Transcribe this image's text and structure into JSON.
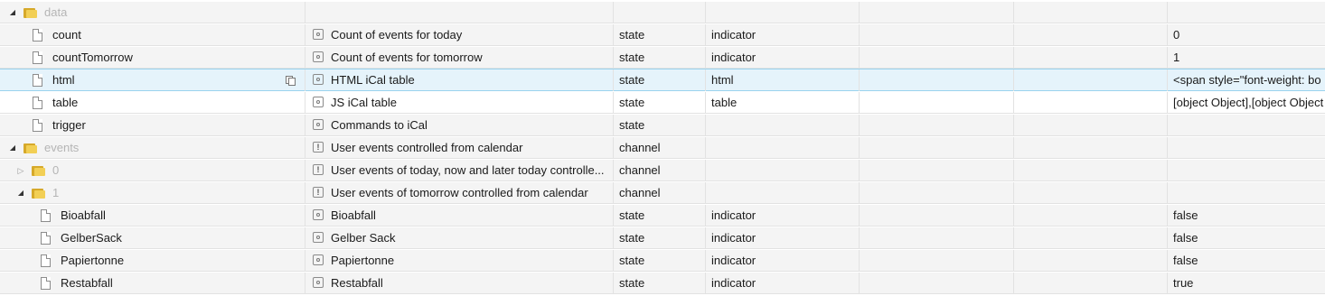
{
  "rows": [
    {
      "name": "data",
      "kind": "folder",
      "expander": "open",
      "desc": "",
      "type": "",
      "role": "",
      "value": ""
    },
    {
      "name": "count",
      "kind": "state",
      "desc": "Count of events for today",
      "type": "state",
      "role": "indicator",
      "value": "0"
    },
    {
      "name": "countTomorrow",
      "kind": "state",
      "desc": "Count of events for tomorrow",
      "type": "state",
      "role": "indicator",
      "value": "1"
    },
    {
      "name": "html",
      "kind": "state",
      "desc": "HTML iCal table",
      "type": "state",
      "role": "html",
      "value": "<span style=\"font-weight: bo"
    },
    {
      "name": "table",
      "kind": "state",
      "desc": "JS iCal table",
      "type": "state",
      "role": "table",
      "value": "[object Object],[object Object"
    },
    {
      "name": "trigger",
      "kind": "state",
      "desc": "Commands to iCal",
      "type": "state",
      "role": "",
      "value": ""
    },
    {
      "name": "events",
      "kind": "folder",
      "expander": "open",
      "desc": "User events controlled from calendar",
      "type": "channel",
      "role": "",
      "value": ""
    },
    {
      "name": "0",
      "kind": "folder",
      "expander": "closed",
      "desc": "User events of today, now and later today controlle...",
      "type": "channel",
      "role": "",
      "value": ""
    },
    {
      "name": "1",
      "kind": "folder",
      "expander": "open",
      "desc": "User events of tomorrow controlled from calendar",
      "type": "channel",
      "role": "",
      "value": ""
    },
    {
      "name": "Bioabfall",
      "kind": "state",
      "desc": "Bioabfall",
      "type": "state",
      "role": "indicator",
      "value": "false"
    },
    {
      "name": "GelberSack",
      "kind": "state",
      "desc": "Gelber Sack",
      "type": "state",
      "role": "indicator",
      "value": "false"
    },
    {
      "name": "Papiertonne",
      "kind": "state",
      "desc": "Papiertonne",
      "type": "state",
      "role": "indicator",
      "value": "false"
    },
    {
      "name": "Restabfall",
      "kind": "state",
      "desc": "Restabfall",
      "type": "state",
      "role": "indicator",
      "value": "true"
    }
  ],
  "icons": {
    "folder": "folder-icon",
    "state": "file-icon",
    "copy": "copy-icon",
    "state_type": "state-type-icon",
    "channel_type": "channel-type-icon"
  },
  "colors": {
    "selected_row": "#e5f3fb",
    "selected_border": "#9ad3ee",
    "alt_row": "#f4f4f4",
    "folder": "#f2cf55",
    "dim_text": "#b5b5b5"
  }
}
